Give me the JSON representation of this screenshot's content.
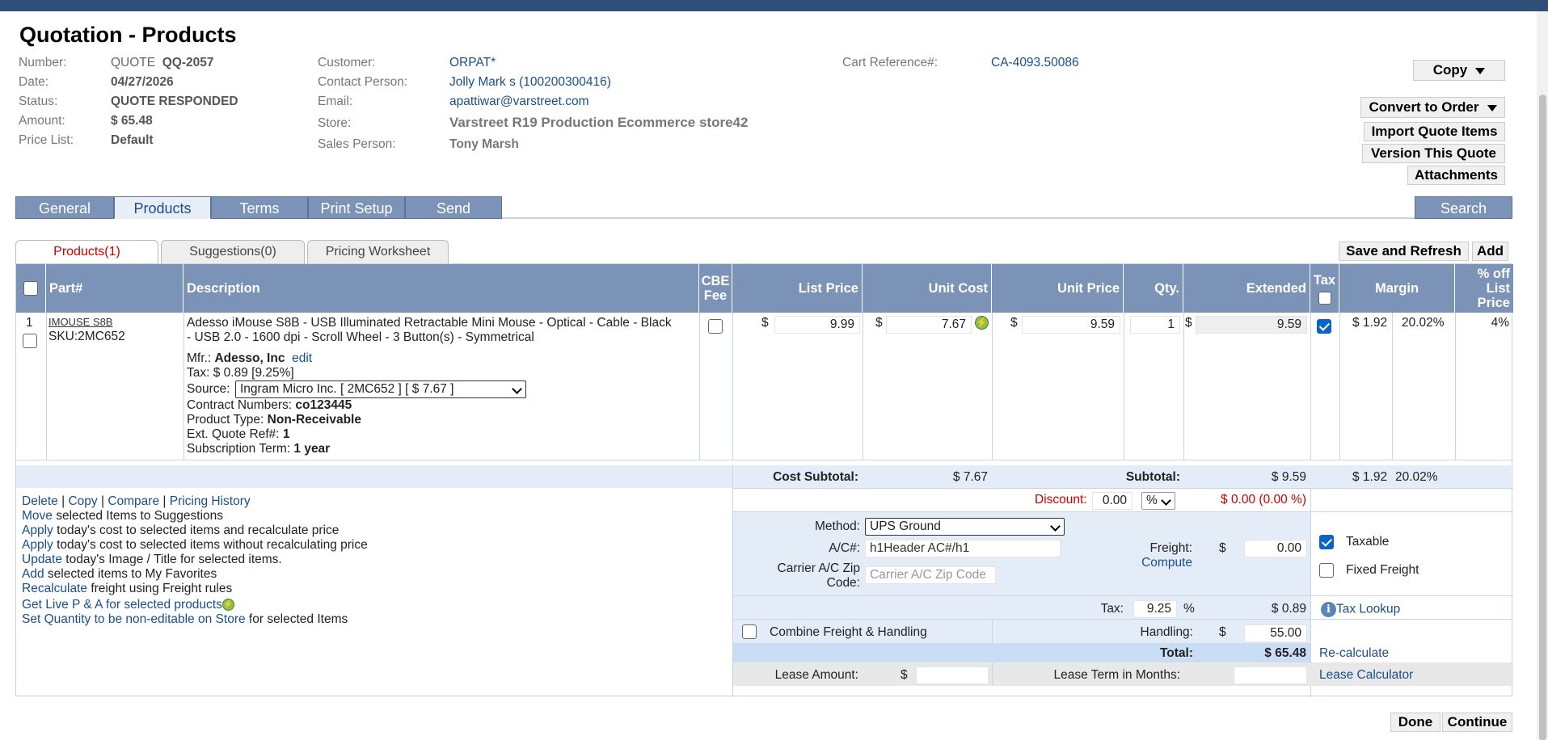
{
  "page": {
    "title": "Quotation - Products"
  },
  "header_left": {
    "number_label": "Number:",
    "number_prefix": "QUOTE",
    "number_value": "QQ-2057",
    "date_label": "Date:",
    "date_value": "04/27/2026",
    "status_label": "Status:",
    "status_value": "QUOTE RESPONDED",
    "amount_label": "Amount:",
    "amount_value": "$ 65.48",
    "pricelist_label": "Price List:",
    "pricelist_value": "Default"
  },
  "header_mid": {
    "customer_label": "Customer:",
    "customer_value": "ORPAT*",
    "contact_label": "Contact Person:",
    "contact_value": "Jolly Mark s (100200300416)",
    "email_label": "Email:",
    "email_value": "apattiwar@varstreet.com",
    "store_label": "Store:",
    "store_value": "Varstreet R19 Production Ecommerce store42",
    "sales_label": "Sales Person:",
    "sales_value": "Tony Marsh"
  },
  "header_right": {
    "cart_label": "Cart Reference#:",
    "cart_value": "CA-4093.50086"
  },
  "actions": {
    "copy": "Copy",
    "convert": "Convert to Order",
    "import": "Import Quote Items",
    "version": "Version This Quote",
    "attachments": "Attachments"
  },
  "tabs": {
    "general": "General",
    "products": "Products",
    "terms": "Terms",
    "print": "Print Setup",
    "send": "Send",
    "search": "Search"
  },
  "subtabs": {
    "products": "Products(1)",
    "suggestions": "Suggestions(0)",
    "pricing": "Pricing Worksheet"
  },
  "grid_actions": {
    "save_refresh": "Save and Refresh",
    "add": "Add"
  },
  "columns": {
    "part": "Part#",
    "description": "Description",
    "cbe": "CBE Fee",
    "list_price": "List Price",
    "unit_cost": "Unit Cost",
    "unit_price": "Unit Price",
    "qty": "Qty.",
    "extended": "Extended",
    "tax": "Tax",
    "margin": "Margin",
    "pct_off": "% off List Price"
  },
  "item": {
    "line": "1",
    "part": "IMOUSE S8B",
    "sku": "SKU:2MC652",
    "description": "Adesso iMouse S8B - USB Illuminated Retractable Mini Mouse - Optical - Cable - Black - USB 2.0 - 1600 dpi - Scroll Wheel - 3 Button(s) - Symmetrical",
    "mfr_label": "Mfr.:",
    "mfr_value": "Adesso, Inc",
    "edit": "edit",
    "tax_line": "Tax: $ 0.89 [9.25%]",
    "source_label": "Source:",
    "source_value": "Ingram Micro Inc. [ 2MC652 ] [ $ 7.67 ]",
    "contract_label": "Contract Numbers:",
    "contract_value": "co123445",
    "ptype_label": "Product Type:",
    "ptype_value": "Non-Receivable",
    "extref_label": "Ext. Quote Ref#:",
    "extref_value": "1",
    "subterm_label": "Subscription Term:",
    "subterm_value": "1 year",
    "currency": "$",
    "list_price": "9.99",
    "unit_cost": "7.67",
    "unit_price": "9.59",
    "qty": "1",
    "extended": "9.59",
    "margin_amt": "$ 1.92",
    "margin_pct": "20.02%",
    "pct_off": "4%"
  },
  "subtotals": {
    "cost_label": "Cost Subtotal:",
    "cost_value": "$ 7.67",
    "sub_label": "Subtotal:",
    "sub_value": "$ 9.59",
    "margin_amt": "$ 1.92",
    "margin_pct": "20.02%"
  },
  "links": {
    "delete": "Delete",
    "copy": "Copy",
    "compare": "Compare",
    "history": "Pricing History",
    "sep": "|",
    "move": "Move",
    "move_rest": "selected Items to Suggestions",
    "apply1": "Apply",
    "apply1_rest": "today's cost to selected items and recalculate price",
    "apply2": "Apply",
    "apply2_rest": "today's cost to selected items without recalculating price",
    "update": "Update",
    "update_rest": "today's Image / Title for selected items.",
    "add": "Add",
    "add_rest": "selected items to My Favorites",
    "recalc": "Recalculate",
    "recalc_rest": "freight using Freight rules",
    "live": "Get Live P & A for selected products",
    "setqty": "Set Quantity to be non-editable on Store",
    "setqty_rest": "for selected Items"
  },
  "discount": {
    "label": "Discount:",
    "value": "0.00",
    "unit": "%",
    "result": "$ 0.00 (0.00 %)"
  },
  "freight": {
    "method_label": "Method:",
    "method_value": "UPS Ground",
    "ac_label": "A/C#:",
    "ac_value": "h1Header AC#/h1",
    "zip_label": "Carrier A/C Zip Code:",
    "zip_placeholder": "Carrier A/C Zip Code",
    "freight_label": "Freight:",
    "compute": "Compute",
    "currency": "$",
    "freight_value": "0.00",
    "taxable": "Taxable",
    "fixed": "Fixed Freight"
  },
  "tax": {
    "label": "Tax:",
    "rate": "9.25",
    "unit": "%",
    "amount": "$ 0.89",
    "lookup": "Tax Lookup"
  },
  "handling": {
    "combine": "Combine Freight & Handling",
    "label": "Handling:",
    "currency": "$",
    "value": "55.00"
  },
  "total": {
    "label": "Total:",
    "value": "$ 65.48",
    "recalc": "Re-calculate"
  },
  "lease": {
    "amount_label": "Lease Amount:",
    "currency": "$",
    "term_label": "Lease Term in Months:",
    "calculator": "Lease Calculator"
  },
  "footer": {
    "done": "Done",
    "continue": "Continue"
  }
}
